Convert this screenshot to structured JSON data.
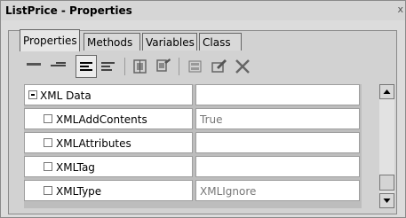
{
  "window": {
    "title": "ListPrice - Properties",
    "close_label": "x"
  },
  "tabs": [
    {
      "label": "Properties",
      "active": true
    },
    {
      "label": "Methods",
      "active": false
    },
    {
      "label": "Variables",
      "active": false
    },
    {
      "label": "Class",
      "active": false
    }
  ],
  "toolbar": {
    "buttons": [
      "thick-line-icon",
      "thin-line-icon",
      "align-left-pressed-icon",
      "align-left-icon",
      "split-column-icon",
      "split-row-icon",
      "new-item-icon",
      "edit-item-icon",
      "delete-icon"
    ]
  },
  "properties": {
    "group": {
      "label": "XML Data",
      "value": ""
    },
    "rows": [
      {
        "label": "XMLAddContents",
        "value": "True"
      },
      {
        "label": "XMLAttributes",
        "value": ""
      },
      {
        "label": "XMLTag",
        "value": ""
      },
      {
        "label": "XMLType",
        "value": "XMLIgnore"
      }
    ]
  },
  "scrollbar": {
    "up_icon": "arrow-up-icon",
    "down_icon": "arrow-down-icon"
  }
}
